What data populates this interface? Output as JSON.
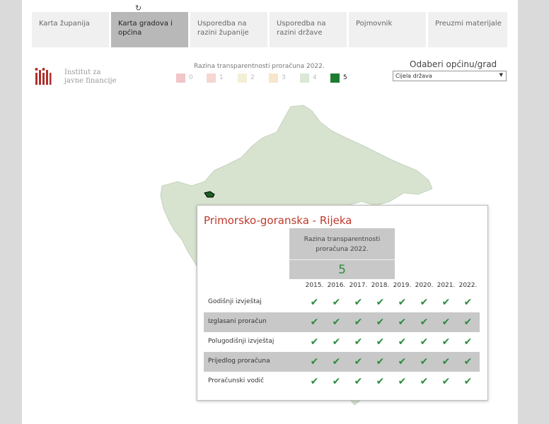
{
  "tabs": [
    {
      "label": "Karta županija",
      "active": false
    },
    {
      "label": "Karta gradova i općina",
      "active": true
    },
    {
      "label": "Usporedba na razini županije",
      "active": false
    },
    {
      "label": "Usporedba na razini države",
      "active": false
    },
    {
      "label": "Pojmovnik",
      "active": false
    },
    {
      "label": "Preuzmi materijale",
      "active": false
    }
  ],
  "refresh_icon": "↻",
  "logo": {
    "line1": "Institut za",
    "line2": "javne financije"
  },
  "legend": {
    "title": "Razina transparentnosti proračuna 2022.",
    "items": [
      {
        "label": "0",
        "color": "#f1c6c8"
      },
      {
        "label": "1",
        "color": "#f5d6d0"
      },
      {
        "label": "2",
        "color": "#f3efd6"
      },
      {
        "label": "3",
        "color": "#f7e6cc"
      },
      {
        "label": "4",
        "color": "#dbe8d6"
      },
      {
        "label": "5",
        "color": "#1e7b32"
      }
    ]
  },
  "selector": {
    "title": "Odaberi općinu/grad",
    "value": "Cijela država",
    "arrow": "▼"
  },
  "map": {
    "fill": "#d7e2cf",
    "selected_fill": "#1c5f24"
  },
  "popup": {
    "title": "Primorsko-goranska - Rijeka",
    "rating_label_line1": "Razina transparentnosti",
    "rating_label_line2": "proračuna  2022.",
    "rating_value": "5",
    "years": [
      "2015.",
      "2016.",
      "2017.",
      "2018.",
      "2019.",
      "2020.",
      "2021.",
      "2022."
    ],
    "rows": [
      {
        "label": "Godišnji izvještaj",
        "shaded": false
      },
      {
        "label": "Izglasani proračun",
        "shaded": true
      },
      {
        "label": "Polugodišnji izvještaj",
        "shaded": false
      },
      {
        "label": "Prijedlog proračuna",
        "shaded": true
      },
      {
        "label": "Proračunski vodič",
        "shaded": false
      }
    ],
    "check_symbol": "✔"
  }
}
